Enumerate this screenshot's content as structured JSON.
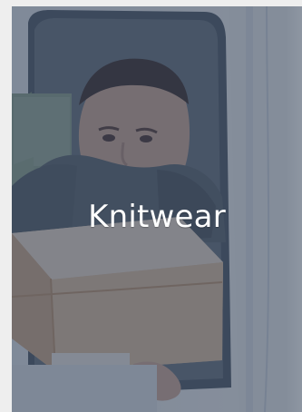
{
  "category_tile": {
    "label": "Knitwear",
    "image": "courier-delivery-photo",
    "overlay_color": "#3f4f67",
    "text_color": "#ffffff"
  }
}
